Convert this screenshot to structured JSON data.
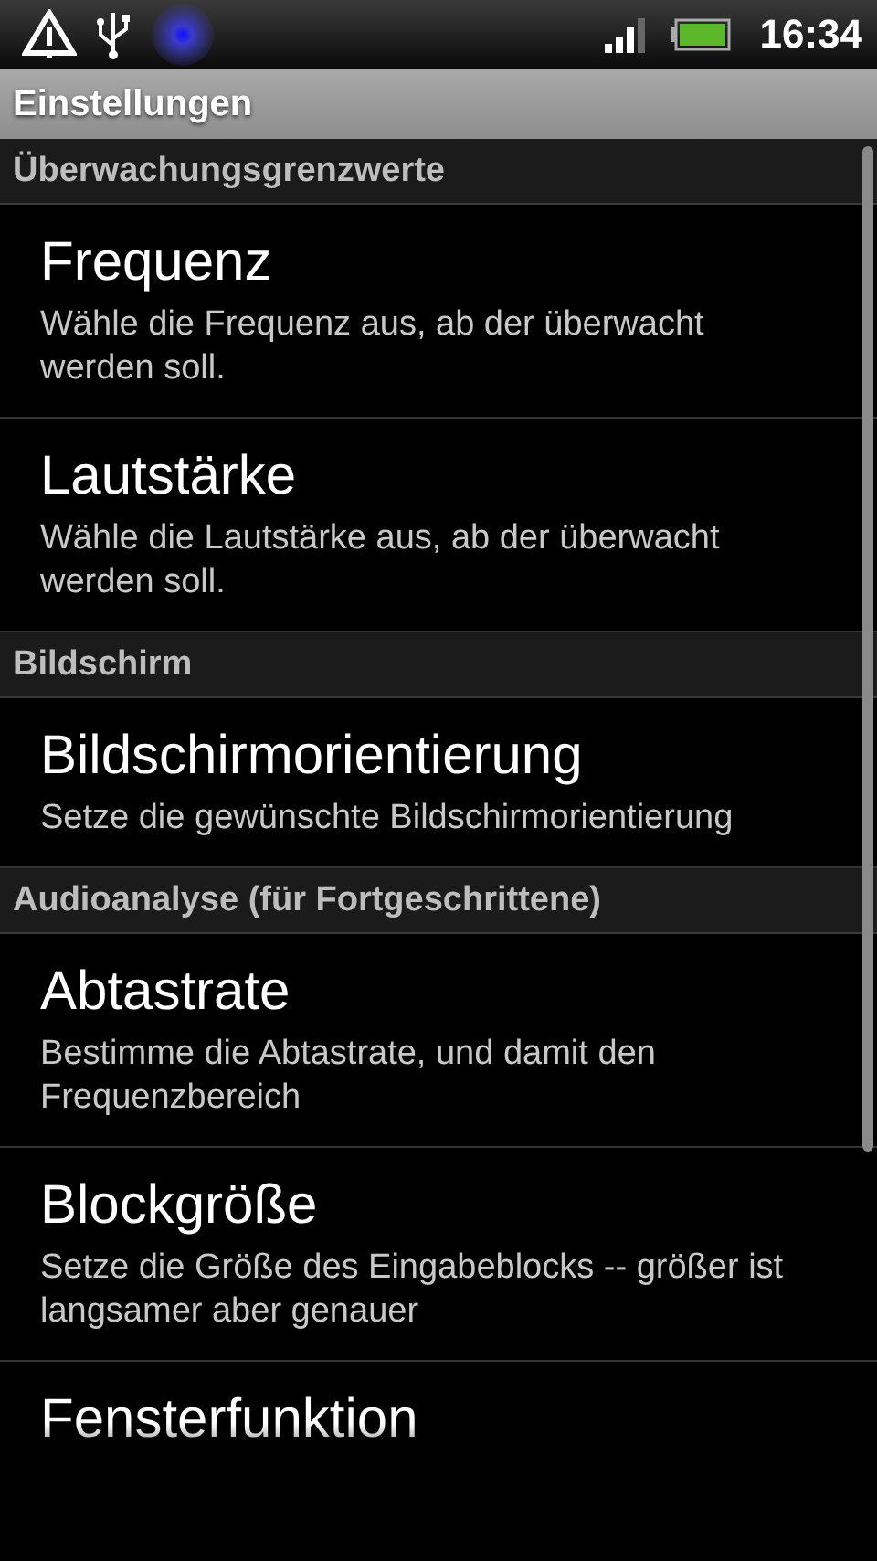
{
  "status_bar": {
    "time": "16:34"
  },
  "title": "Einstellungen",
  "sections": [
    {
      "header": "Überwachungsgrenzwerte",
      "items": [
        {
          "title": "Frequenz",
          "summary": "Wähle die Frequenz aus, ab der überwacht werden soll."
        },
        {
          "title": "Lautstärke",
          "summary": "Wähle die Lautstärke aus, ab der überwacht werden soll."
        }
      ]
    },
    {
      "header": "Bildschirm",
      "items": [
        {
          "title": "Bildschirmorientierung",
          "summary": "Setze die gewünschte Bildschirmorientierung"
        }
      ]
    },
    {
      "header": "Audioanalyse (für Fortgeschrittene)",
      "items": [
        {
          "title": "Abtastrate",
          "summary": "Bestimme die Abtastrate, und damit den Frequenzbereich"
        },
        {
          "title": "Blockgröße",
          "summary": "Setze die Größe des Eingabeblocks -- größer ist langsamer aber genauer"
        },
        {
          "title": "Fensterfunktion"
        }
      ]
    }
  ]
}
